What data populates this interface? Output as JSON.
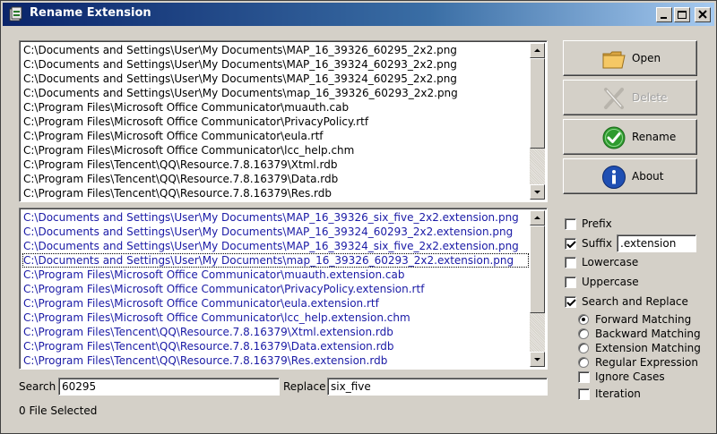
{
  "window": {
    "title": "Rename Extension"
  },
  "source_list": {
    "items": [
      "C:\\Documents and Settings\\User\\My Documents\\MAP_16_39326_60295_2x2.png",
      "C:\\Documents and Settings\\User\\My Documents\\MAP_16_39324_60293_2x2.png",
      "C:\\Documents and Settings\\User\\My Documents\\MAP_16_39324_60295_2x2.png",
      "C:\\Documents and Settings\\User\\My Documents\\map_16_39326_60293_2x2.png",
      "C:\\Program Files\\Microsoft Office Communicator\\muauth.cab",
      "C:\\Program Files\\Microsoft Office Communicator\\PrivacyPolicy.rtf",
      "C:\\Program Files\\Microsoft Office Communicator\\eula.rtf",
      "C:\\Program Files\\Microsoft Office Communicator\\lcc_help.chm",
      "C:\\Program Files\\Tencent\\QQ\\Resource.7.8.16379\\Xtml.rdb",
      "C:\\Program Files\\Tencent\\QQ\\Resource.7.8.16379\\Data.rdb",
      "C:\\Program Files\\Tencent\\QQ\\Resource.7.8.16379\\Res.rdb"
    ]
  },
  "result_list": {
    "items": [
      "C:\\Documents and Settings\\User\\My Documents\\MAP_16_39326_six_five_2x2.extension.png",
      "C:\\Documents and Settings\\User\\My Documents\\MAP_16_39324_60293_2x2.extension.png",
      "C:\\Documents and Settings\\User\\My Documents\\MAP_16_39324_six_five_2x2.extension.png",
      "C:\\Documents and Settings\\User\\My Documents\\map_16_39326_60293_2x2.extension.png",
      "C:\\Program Files\\Microsoft Office Communicator\\muauth.extension.cab",
      "C:\\Program Files\\Microsoft Office Communicator\\PrivacyPolicy.extension.rtf",
      "C:\\Program Files\\Microsoft Office Communicator\\eula.extension.rtf",
      "C:\\Program Files\\Microsoft Office Communicator\\lcc_help.extension.chm",
      "C:\\Program Files\\Tencent\\QQ\\Resource.7.8.16379\\Xtml.extension.rdb",
      "C:\\Program Files\\Tencent\\QQ\\Resource.7.8.16379\\Data.extension.rdb",
      "C:\\Program Files\\Tencent\\QQ\\Resource.7.8.16379\\Res.extension.rdb"
    ],
    "focused_index": 3
  },
  "buttons": {
    "open": "Open",
    "delete": "Delete",
    "rename": "Rename",
    "about": "About"
  },
  "options": {
    "prefix": {
      "label": "Prefix",
      "checked": false
    },
    "suffix": {
      "label": "Suffix",
      "checked": true,
      "value": ".extension"
    },
    "lowercase": {
      "label": "Lowercase",
      "checked": false
    },
    "uppercase": {
      "label": "Uppercase",
      "checked": false
    },
    "search_replace": {
      "label": "Search and Replace",
      "checked": true
    },
    "matching": {
      "forward": "Forward Matching",
      "backward": "Backward Matching",
      "extension": "Extension Matching",
      "regex": "Regular Expression",
      "selected": "forward"
    },
    "ignore_cases": {
      "label": "Ignore Cases",
      "checked": false
    },
    "iteration": {
      "label": "Iteration",
      "checked": false
    }
  },
  "search": {
    "label": "Search",
    "value": "60295"
  },
  "replace": {
    "label": "Replace",
    "value": "six_five"
  },
  "status": {
    "text": "0 File Selected"
  },
  "colors": {
    "title_gradient_start": "#0a246a",
    "result_text": "#1a1aa6",
    "face": "#d4d0c8"
  }
}
